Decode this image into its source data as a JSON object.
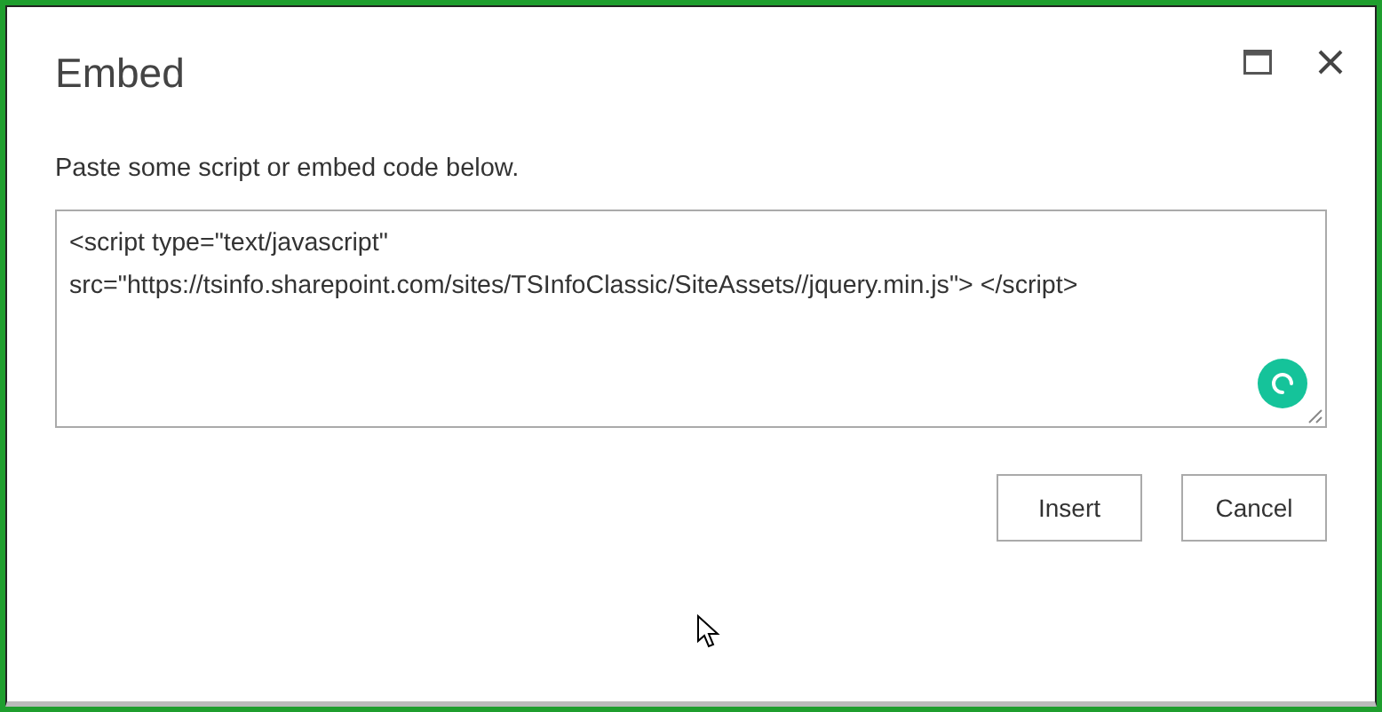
{
  "dialog": {
    "title": "Embed",
    "instruction": "Paste some script or embed code below.",
    "code": {
      "value": "<script type=\"text/javascript\"\nsrc=\"https://tsinfo.sharepoint.com/sites/TSInfoClassic/SiteAssets//jquery.min.js\"> </script>"
    },
    "buttons": [
      "Insert",
      "Cancel"
    ]
  }
}
